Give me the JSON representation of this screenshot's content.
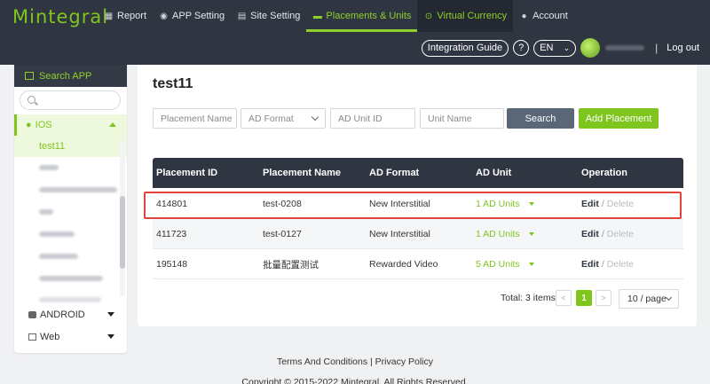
{
  "brand": {
    "logo": "Mintegral"
  },
  "nav": [
    {
      "label": "Report",
      "icon": "grid-icon"
    },
    {
      "label": "APP Setting",
      "icon": "android-icon"
    },
    {
      "label": "Site Setting",
      "icon": "list-icon"
    },
    {
      "label": "Placements & Units",
      "icon": "folder-icon",
      "active": true
    },
    {
      "label": "Virtual Currency",
      "icon": "coin-icon"
    },
    {
      "label": "Account",
      "icon": "user-icon"
    }
  ],
  "topright": {
    "integration_guide": "Integration Guide",
    "help": "?",
    "lang": "EN",
    "separator": "|",
    "logout": "Log out"
  },
  "sidebar": {
    "header": "Search APP",
    "search_placeholder": "",
    "ios_label": "IOS",
    "active_app": "test11",
    "android_label": "ANDROID",
    "web_label": "Web"
  },
  "main": {
    "title": "test11",
    "filters": {
      "placement_name": "Placement Name",
      "ad_format": "AD Format",
      "ad_unit_id": "AD Unit ID",
      "unit_name": "Unit Name"
    },
    "search_button": "Search",
    "add_button": "Add Placement",
    "table": {
      "headers": [
        "Placement ID",
        "Placement Name",
        "AD Format",
        "AD Unit",
        "Operation"
      ],
      "rows": [
        {
          "id": "414801",
          "name": "test-0208",
          "format": "New Interstitial",
          "unit": "1 AD Units",
          "edit": "Edit",
          "slash": "/",
          "delete": "Delete"
        },
        {
          "id": "411723",
          "name": "test-0127",
          "format": "New Interstitial",
          "unit": "1 AD Units",
          "edit": "Edit",
          "slash": "/",
          "delete": "Delete"
        },
        {
          "id": "195148",
          "name": "批量配置测试",
          "format": "Rewarded Video",
          "unit": "5 AD Units",
          "edit": "Edit",
          "slash": "/",
          "delete": "Delete"
        }
      ]
    },
    "pagination": {
      "total": "Total: 3 items",
      "prev": "<",
      "current": "1",
      "next": ">",
      "per_page": "10 / page"
    }
  },
  "footer": {
    "links": "Terms And Conditions | Privacy Policy",
    "copyright": "Copyright © 2015-2022 Mintegral. All Rights Reserved."
  },
  "colors": {
    "accent": "#7ec61d",
    "dark": "#2f3541",
    "highlight": "#e0443b"
  }
}
